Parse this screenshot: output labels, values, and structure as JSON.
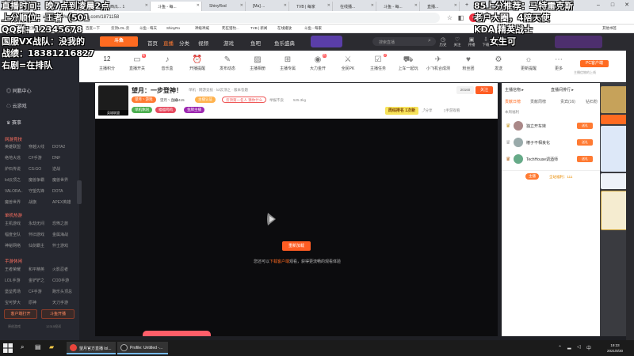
{
  "browser": {
    "tabs": [
      {
        "label": "[云顶之]"
      },
      {
        "label": "LOL云顶..."
      },
      {
        "label": "西瓜... 1"
      },
      {
        "label": "斗鱼 - 每..."
      },
      {
        "label": "ShinyRod"
      },
      {
        "label": "[Ma] ..."
      },
      {
        "label": "TVB | 每家"
      },
      {
        "label": "在线播..."
      },
      {
        "label": "斗鱼 - 每..."
      },
      {
        "label": "直播..."
      }
    ],
    "url": "https://www.douyu.com/1871158",
    "bookmarks": [
      "应用",
      "【云顶之】",
      "LOL云顶之",
      "百度一下",
      "云顶LOL.云",
      "斗鱼 - 每天",
      "ShinyRo",
      "神级神威",
      "死狂猎豹...",
      "TVB | 新闻",
      "在线播放",
      "斗鱼 - 每家",
      "其他书签"
    ]
  },
  "douyu_header": {
    "logo": "斗鱼",
    "nav": [
      "首页",
      "直播",
      "分类",
      "视频",
      "游戏",
      "鱼吧",
      "鱼乐盛典"
    ],
    "search_placeholder": "搜索直播",
    "icons": [
      "历史",
      "关注",
      "开播",
      "下载",
      "任务"
    ]
  },
  "sidebar": {
    "top_items": [
      "同鹏中心",
      "云游戏",
      "赛事"
    ],
    "sections": [
      {
        "title": "网游竞技",
        "rows": [
          [
            "英雄联盟",
            "穿越火线",
            "DOTA2"
          ],
          [
            "绝地大逃",
            "CF手游",
            "DNF"
          ],
          [
            "炉石传说",
            "CS:GO",
            "逆战"
          ],
          [
            "lol云顶之",
            "魔兽争霸",
            "魔兽世界"
          ],
          [
            "VALORA..",
            "守望先锋",
            "DOTA"
          ],
          [
            "魔兽世界",
            "战旗",
            "APEX英雄"
          ]
        ]
      },
      {
        "title": "单机热游",
        "rows": [
          [
            "主机游戏",
            "永劫无间",
            "恐怖之旅"
          ],
          [
            "幅度全队",
            "怀旧游戏",
            "金属海战"
          ],
          [
            "神秘网络",
            "仙剑霸主",
            "怀士游戏"
          ]
        ]
      },
      {
        "title": "手游休闲",
        "rows": [
          [
            "王者荣耀",
            "和平精英",
            "火影忍者"
          ],
          [
            "LOL手游",
            "金铲铲之",
            "COD手游"
          ],
          [
            "堡垒秀场",
            "CF手游",
            "跑乐头顶总"
          ],
          [
            "宝可梦大",
            "原神",
            "天刀手游"
          ]
        ]
      }
    ],
    "footer_buttons": [
      "客户端打开",
      "斗鱼开播"
    ],
    "footer_text": [
      "原创游戏",
      "12315投诉"
    ]
  },
  "categories": [
    {
      "label": "12",
      "sub": "主播积分"
    },
    {
      "label": "直播开关",
      "badge": "新"
    },
    {
      "label": "音乐盒"
    },
    {
      "label": "开播提醒"
    },
    {
      "label": "发布动态"
    },
    {
      "label": "主播相册"
    },
    {
      "label": "主播专属"
    },
    {
      "label": "大力金开",
      "badge": "热"
    },
    {
      "label": "全民PK"
    },
    {
      "label": "主播任务",
      "badge": "2"
    },
    {
      "label": "上车一起玩"
    },
    {
      "label": "小飞机合成测"
    },
    {
      "label": "粉丝团"
    },
    {
      "label": "发送"
    },
    {
      "label": "更新提醒"
    },
    {
      "label": "更多"
    }
  ],
  "pc_client_btn": "PC客户端",
  "pc_client_sub": "主播信物的上线",
  "room": {
    "title": "望月：一步登神！",
    "category": "单机 · 网游竞技 · lol云顶之 · 版本答题",
    "host_tag": "望月丶游戏",
    "sub_host": "望月丶直播",
    "stats": "119415",
    "tags": [
      "主播认证",
      "云顶第一名人 猜你什么"
    ],
    "pills": [
      "单机休闲",
      "福福鸣鸣",
      "金牌主播"
    ],
    "report": "举报不良",
    "fans": "525.3kg",
    "follow_label": "关注",
    "follow_count": "20160",
    "rank_label": "周综排名 1次新",
    "share": "分享",
    "client_watch": "手游观看",
    "avatar_tag": "英雄联盟"
  },
  "player": {
    "retry_label": "重新加载",
    "hint_before": "您还可以",
    "hint_link": "下载客户端",
    "hint_after": "观看，获得更流畅的观看体验"
  },
  "rank_panel": {
    "header": "主播信物 ▸",
    "header_right": "直播间排行 ▸",
    "tabs": [
      "贡献日榜",
      "贡献周榜",
      "贵宾(16)",
      "钻石粉"
    ],
    "subheader": "本周福利",
    "rows": [
      {
        "name": "独立开车妹",
        "badge": "送礼"
      },
      {
        "name": "椿子不相良化",
        "badge": "送礼"
      },
      {
        "name": "TechHouse调酒师",
        "badge": "送礼"
      }
    ],
    "bottom_btn": "主播",
    "bottom_text": "全站福利：111"
  },
  "overlays": [
    "直播时间：晚7点到凌晨2点",
    "上分顺位：王者（501",
    "QQ群：12345678",
    "国服VX战队：没我的",
    "战绩：18381216827",
    "右剧=在排队",
    "85上分推荐：马特雷克斯",
    "老户大圈，4陪天使",
    "KDA  精英战士",
    "女生可"
  ],
  "taskbar": {
    "apps": [
      "望月官方直播 lol...",
      "Profile: Untitled -..."
    ],
    "time": "19:33",
    "date": "2021/8/30"
  }
}
